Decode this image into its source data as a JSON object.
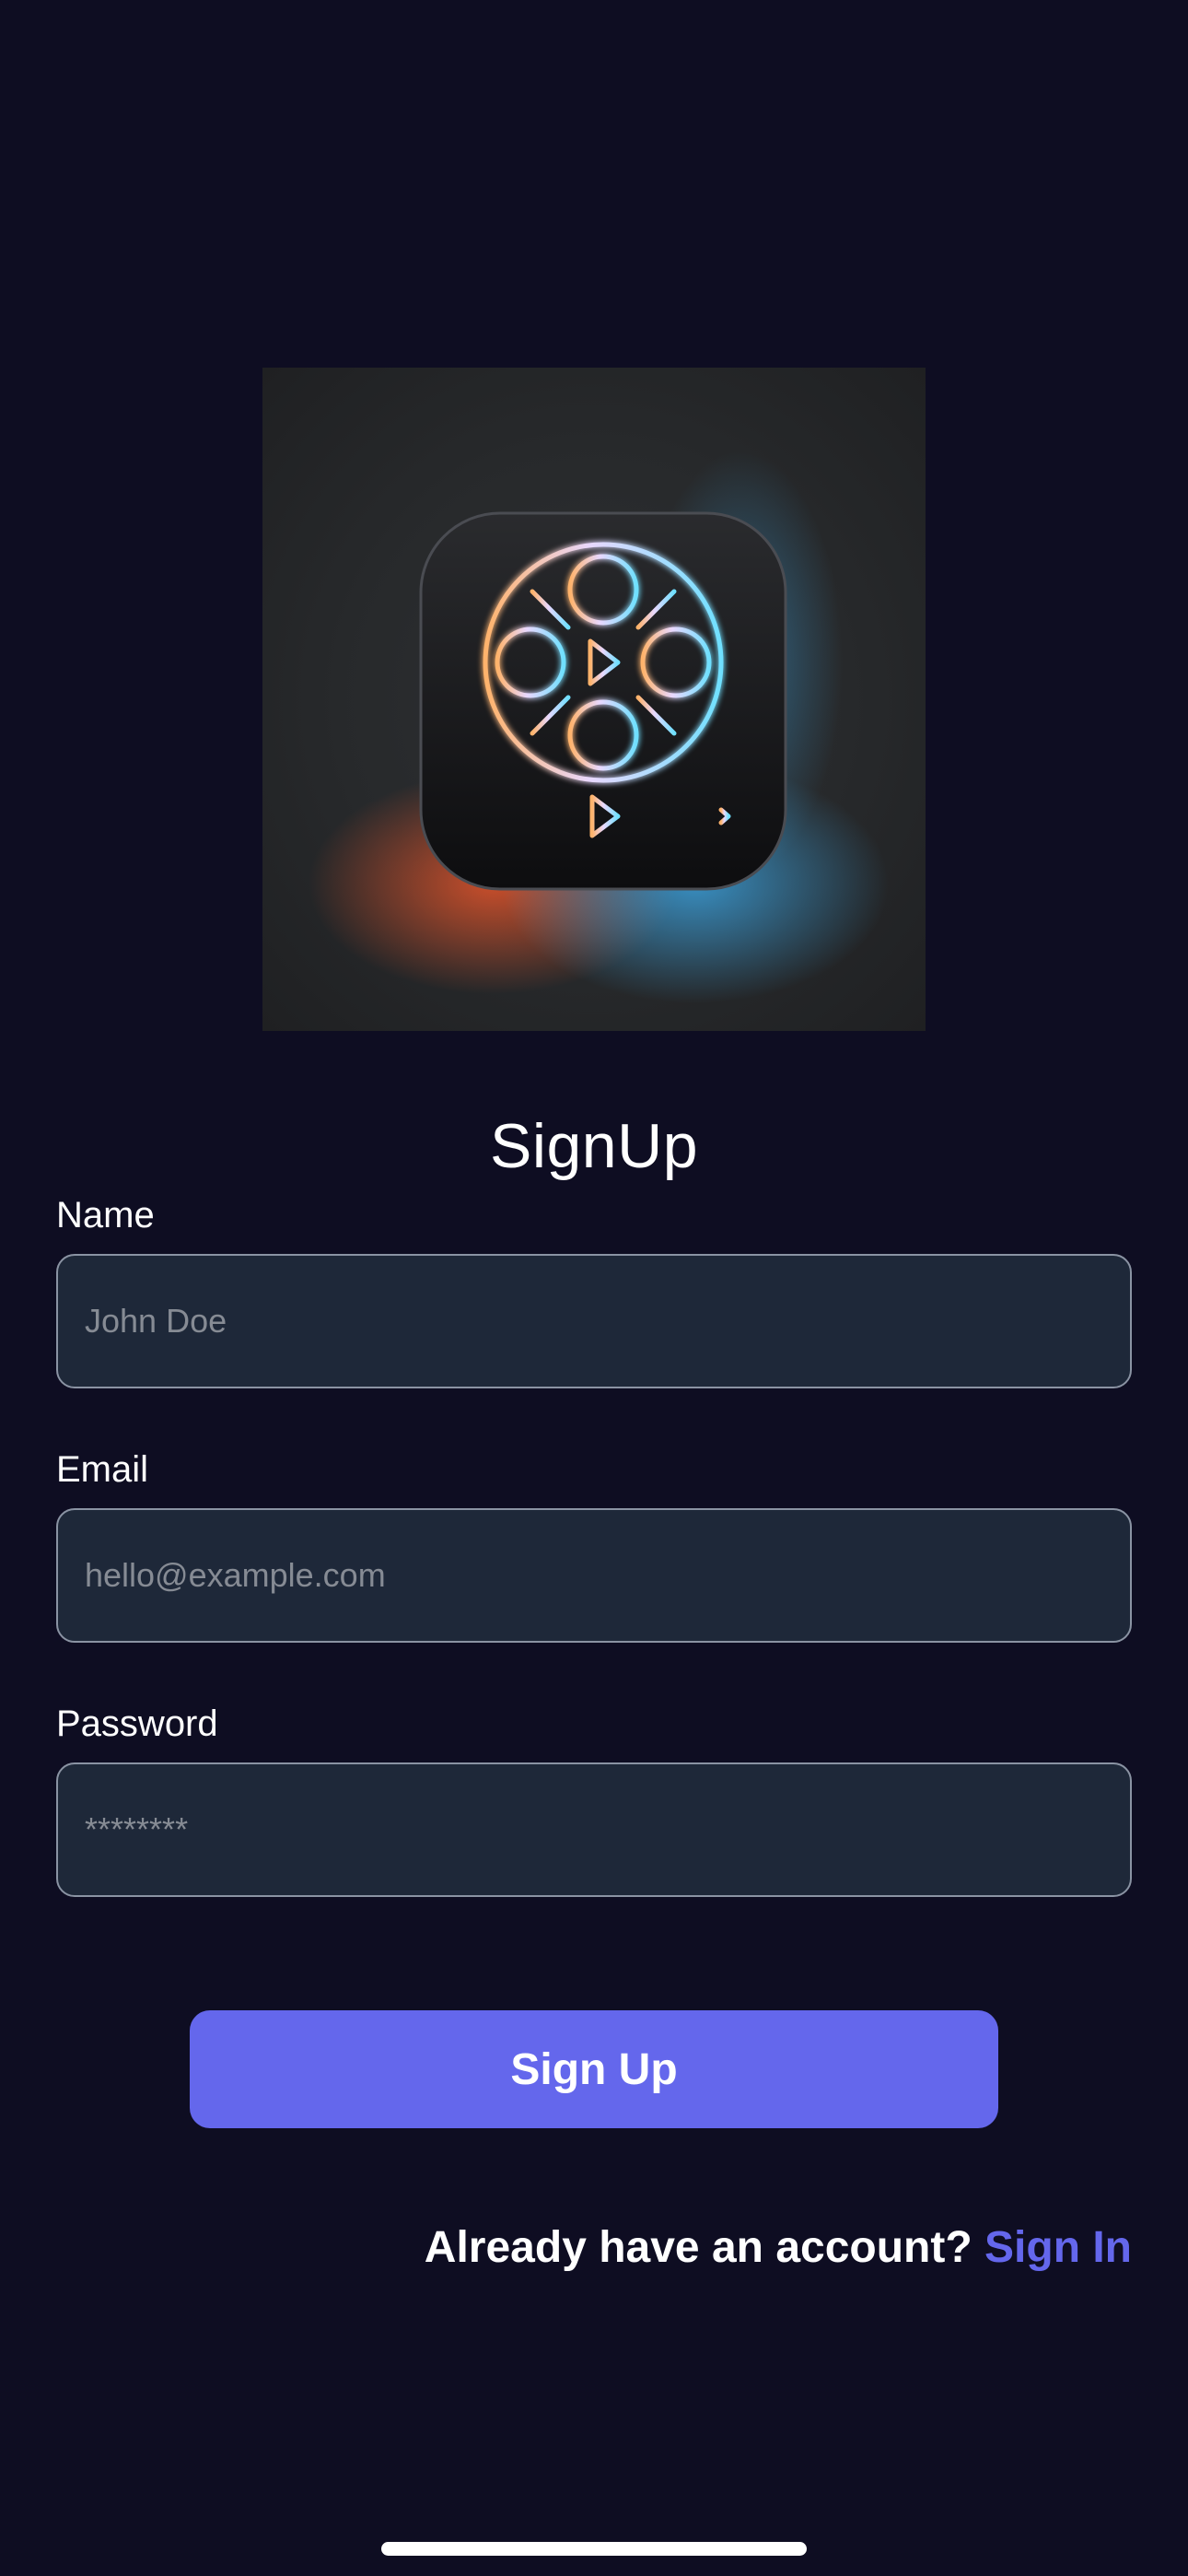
{
  "logo": {
    "icon": "film-reel-play-icon",
    "glow_colors": [
      "#ff7a4a",
      "#5fd6ff"
    ]
  },
  "title": "SignUp",
  "form": {
    "name": {
      "label": "Name",
      "placeholder": "John Doe"
    },
    "email": {
      "label": "Email",
      "placeholder": "hello@example.com"
    },
    "password": {
      "label": "Password",
      "placeholder": "********"
    }
  },
  "signup_button": {
    "label": "Sign Up"
  },
  "footer": {
    "prompt": "Already have an account?",
    "link_label": "Sign In"
  },
  "colors": {
    "background": "#0e0d22",
    "input_fill": "#1e2839",
    "accent": "#6467ec"
  }
}
